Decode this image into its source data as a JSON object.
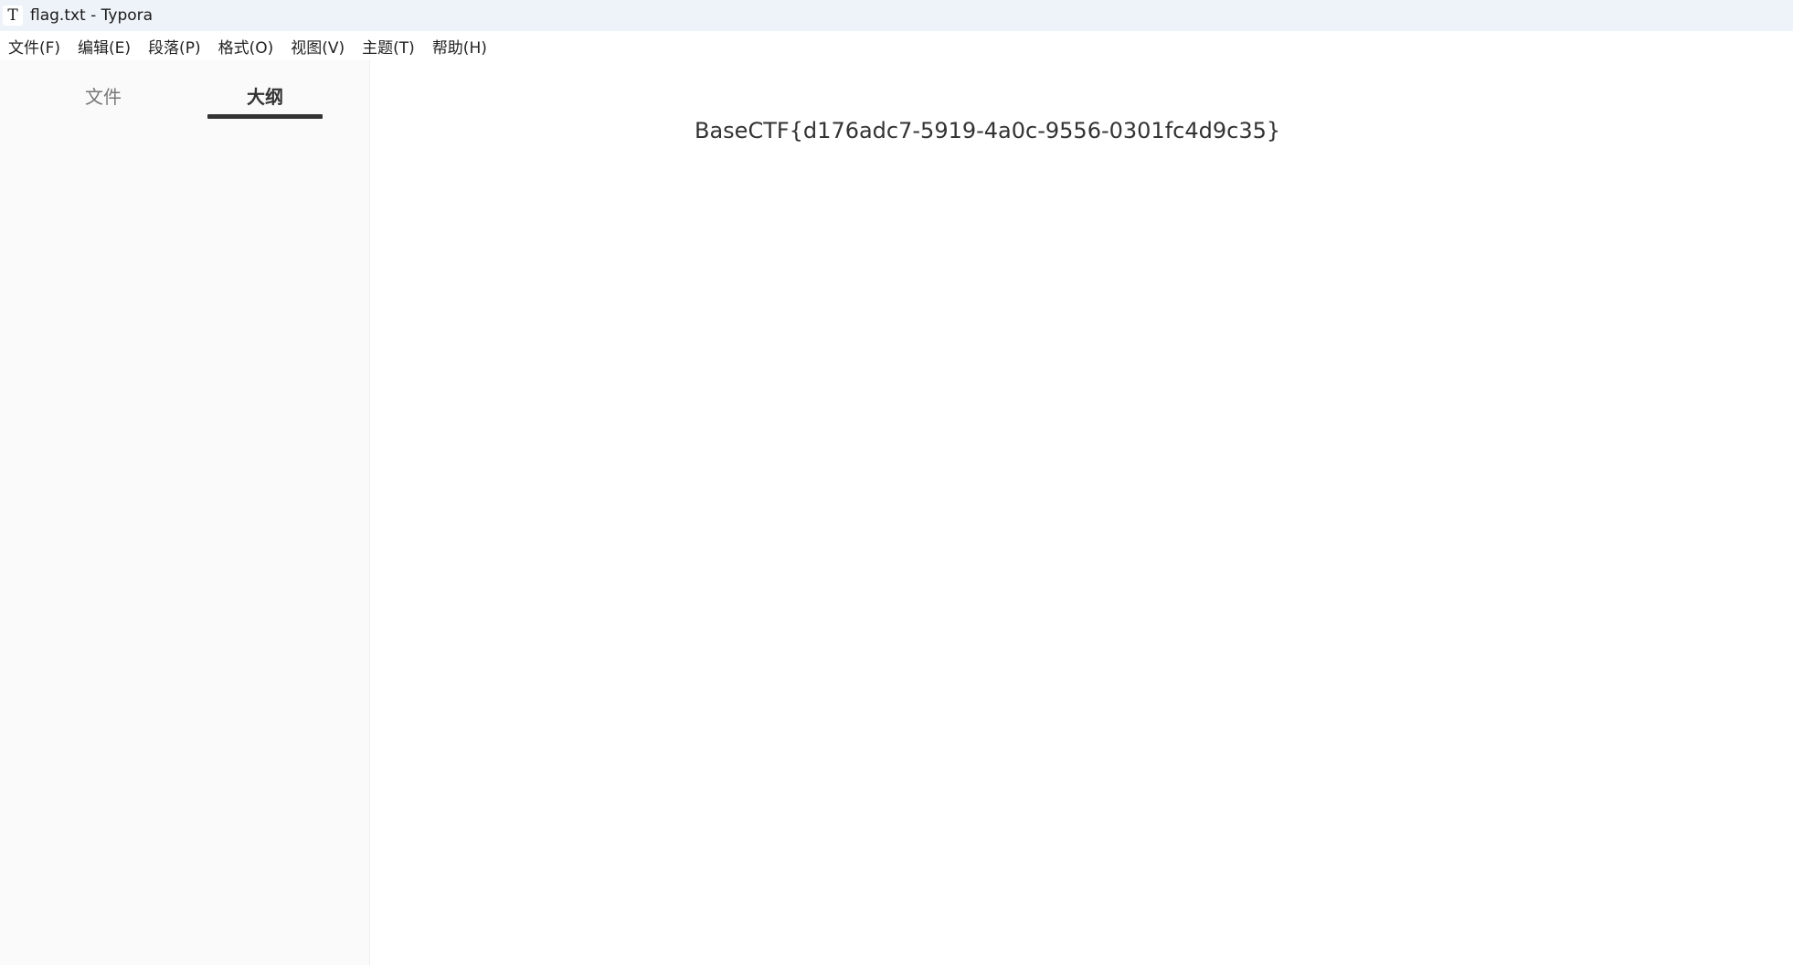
{
  "window": {
    "app_icon_glyph": "T",
    "title": "flag.txt - Typora"
  },
  "menubar": {
    "items": [
      {
        "label": "文件(F)"
      },
      {
        "label": "编辑(E)"
      },
      {
        "label": "段落(P)"
      },
      {
        "label": "格式(O)"
      },
      {
        "label": "视图(V)"
      },
      {
        "label": "主题(T)"
      },
      {
        "label": "帮助(H)"
      }
    ]
  },
  "sidebar": {
    "tabs": [
      {
        "label": "文件",
        "active": false
      },
      {
        "label": "大纲",
        "active": true
      }
    ]
  },
  "editor": {
    "content": "BaseCTF{d176adc7-5919-4a0c-9556-0301fc4d9c35}"
  },
  "colors": {
    "titlebar_bg": "#eef3f9",
    "sidebar_bg": "#fafafa",
    "text": "#333333",
    "active_tab_underline": "#333333"
  }
}
